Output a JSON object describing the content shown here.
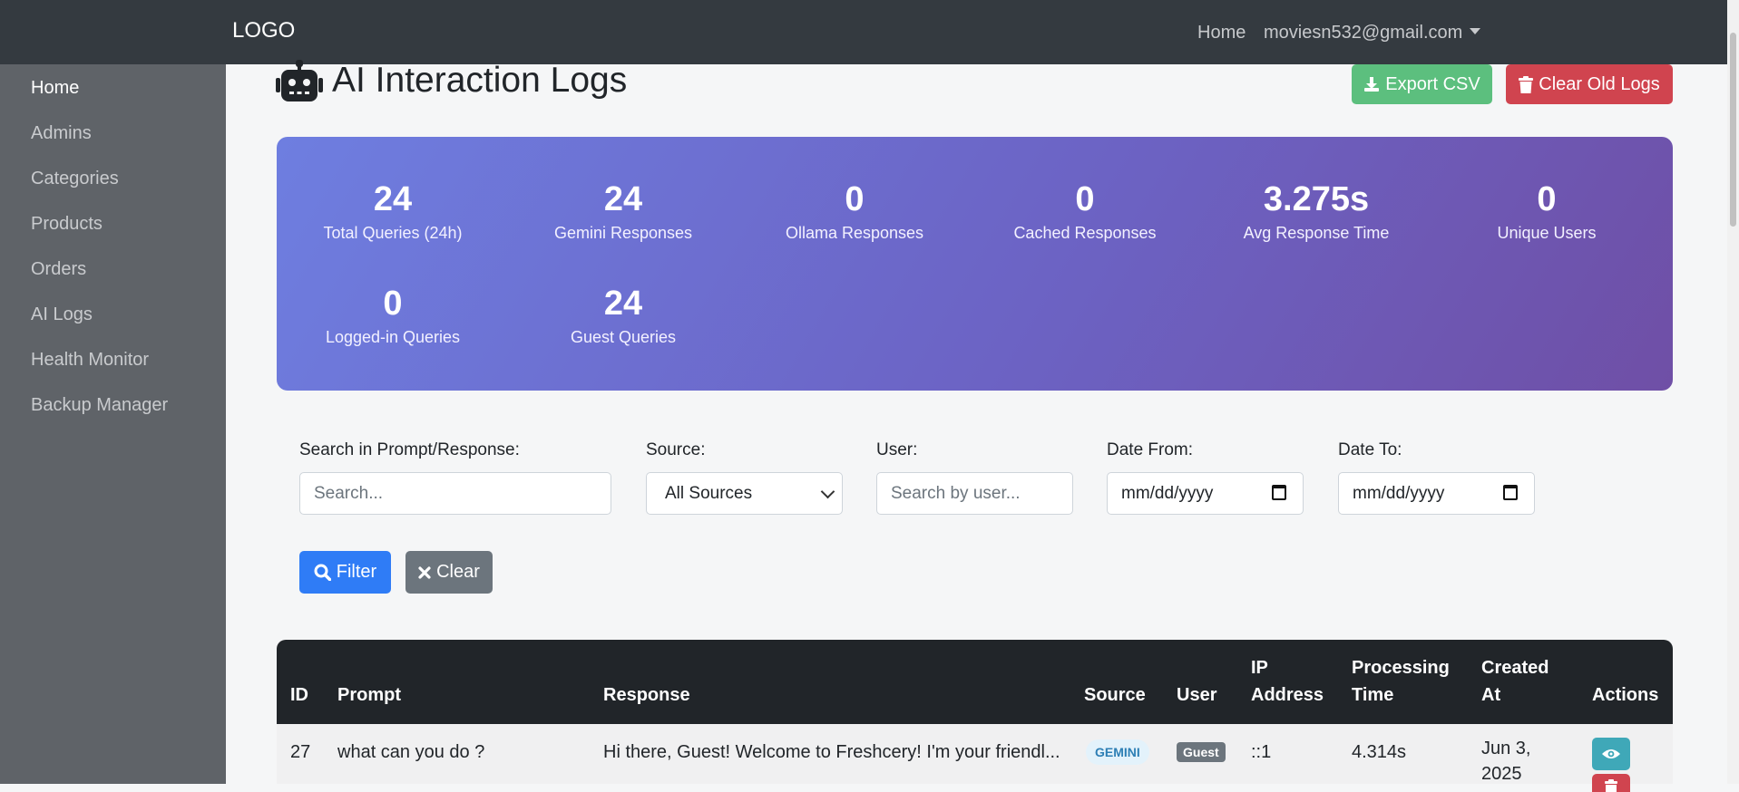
{
  "navbar": {
    "brand": "LOGO",
    "home_label": "Home",
    "user_email": "moviesn532@gmail.com"
  },
  "sidebar": {
    "items": [
      {
        "label": "Home",
        "active": true
      },
      {
        "label": "Admins"
      },
      {
        "label": "Categories"
      },
      {
        "label": "Products"
      },
      {
        "label": "Orders"
      },
      {
        "label": "AI Logs"
      },
      {
        "label": "Health Monitor"
      },
      {
        "label": "Backup Manager"
      }
    ]
  },
  "page": {
    "title": "AI Interaction Logs",
    "icon": "robot-icon",
    "export_label": "Export CSV",
    "clear_logs_label": "Clear Old Logs"
  },
  "stats": [
    {
      "value": "24",
      "label": "Total Queries (24h)"
    },
    {
      "value": "24",
      "label": "Gemini Responses"
    },
    {
      "value": "0",
      "label": "Ollama Responses"
    },
    {
      "value": "0",
      "label": "Cached Responses"
    },
    {
      "value": "3.275s",
      "label": "Avg Response Time"
    },
    {
      "value": "0",
      "label": "Unique Users"
    },
    {
      "value": "0",
      "label": "Logged-in Queries"
    },
    {
      "value": "24",
      "label": "Guest Queries"
    }
  ],
  "filters": {
    "search_label": "Search in Prompt/Response:",
    "search_placeholder": "Search...",
    "source_label": "Source:",
    "source_selected": "All Sources",
    "user_label": "User:",
    "user_placeholder": "Search by user...",
    "date_from_label": "Date From:",
    "date_from_value": "mm/dd/yyyy",
    "date_to_label": "Date To:",
    "date_to_value": "mm/dd/yyyy",
    "filter_button": "Filter",
    "clear_button": "Clear"
  },
  "table": {
    "headers": {
      "id": "ID",
      "prompt": "Prompt",
      "response": "Response",
      "source": "Source",
      "user": "User",
      "ip_line1": "IP",
      "ip_line2": "Address",
      "proc_line1": "Processing",
      "proc_line2": "Time",
      "created_line1": "Created",
      "created_line2": "At",
      "actions": "Actions"
    },
    "rows": [
      {
        "id": "27",
        "prompt": "what can you do ?",
        "response": "Hi there, Guest! Welcome to Freshcery! I'm your friendl...",
        "source": "GEMINI",
        "user": "Guest",
        "ip": "::1",
        "processing_time": "4.314s",
        "created_line1": "Jun 3,",
        "created_line2": "2025"
      }
    ]
  },
  "colors": {
    "navbar": "#343a40",
    "sidebar": "#5f6368",
    "export_button": "#5cbf7e",
    "danger_button": "#d0444f",
    "primary_button": "#2f7cf6",
    "secondary_button": "#6c757d",
    "stats_gradient_start": "#6e7ee0",
    "stats_gradient_end": "#6f4fa6",
    "info_button": "#3fa8b8"
  }
}
